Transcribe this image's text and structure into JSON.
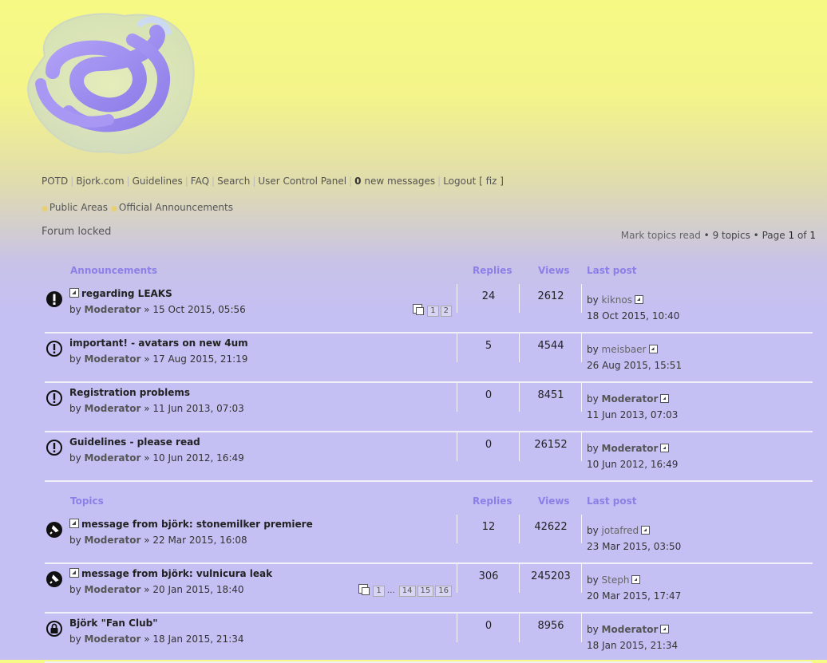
{
  "nav": {
    "links": [
      "POTD",
      "Bjork.com",
      "Guidelines",
      "FAQ",
      "Search",
      "User Control Panel"
    ],
    "new_messages_count": "0",
    "new_messages_label": "new messages",
    "logout": "Logout [ fiz ]"
  },
  "breadcrumbs": [
    "Public Areas",
    "Official Announcements"
  ],
  "forum_status": "Forum locked",
  "pagination": {
    "mark_read": "Mark topics read",
    "topics": "• 9 topics •",
    "page_label": "Page",
    "current": "1",
    "of_label": "of",
    "total": "1"
  },
  "announcements": {
    "header": {
      "title": "Announcements",
      "replies": "Replies",
      "views": "Views",
      "last_post": "Last post"
    },
    "rows": [
      {
        "title": "regarding LEAKS",
        "author": "Moderator",
        "date": "» 15 Oct 2015, 05:56",
        "replies": "24",
        "views": "2612",
        "last_user": "kiknos",
        "last_date": "18 Oct 2015, 10:40",
        "pages": [
          "1",
          "2"
        ]
      },
      {
        "title": "important! - avatars on new 4um",
        "author": "Moderator",
        "date": "» 17 Aug 2015, 21:19",
        "replies": "5",
        "views": "4544",
        "last_user": "meisbaer",
        "last_date": "26 Aug 2015, 15:51"
      },
      {
        "title": "Registration problems",
        "author": "Moderator",
        "date": "» 11 Jun 2013, 07:03",
        "replies": "0",
        "views": "8451",
        "last_user": "Moderator",
        "last_date": "11 Jun 2013, 07:03"
      },
      {
        "title": "Guidelines - please read",
        "author": "Moderator",
        "date": "» 10 Jun 2012, 16:49",
        "replies": "0",
        "views": "26152",
        "last_user": "Moderator",
        "last_date": "10 Jun 2012, 16:49"
      }
    ]
  },
  "topics": {
    "header": {
      "title": "Topics",
      "replies": "Replies",
      "views": "Views",
      "last_post": "Last post"
    },
    "rows": [
      {
        "title": "message from björk: stonemilker premiere",
        "author": "Moderator",
        "date": "» 22 Mar 2015, 16:08",
        "replies": "12",
        "views": "42622",
        "last_user": "jotafred",
        "last_date": "23 Mar 2015, 03:50"
      },
      {
        "title": "message from björk: vulnicura leak",
        "author": "Moderator",
        "date": "» 20 Jan 2015, 18:40",
        "replies": "306",
        "views": "245203",
        "last_user": "Steph",
        "last_date": "20 Mar 2015, 17:47",
        "pages": [
          "1",
          "…",
          "14",
          "15",
          "16"
        ]
      },
      {
        "title": "Björk \"Fan Club\"",
        "author": "Moderator",
        "date": "» 18 Jan 2015, 21:34",
        "replies": "0",
        "views": "8956",
        "last_user": "Moderator",
        "last_date": "18 Jan 2015, 21:34"
      }
    ]
  },
  "by_label": "by",
  "icons": [
    "announcement-filled-icon",
    "announcement-icon",
    "sticky-icon",
    "locked-icon",
    "new-post-icon",
    "view-latest-icon",
    "multipage-icon"
  ]
}
